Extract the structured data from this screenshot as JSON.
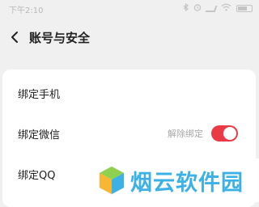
{
  "status_bar": {
    "time": "下午2:10",
    "icons": [
      "bluetooth-icon",
      "alarm-icon",
      "signal-icon",
      "wifi-icon",
      "battery-icon"
    ]
  },
  "header": {
    "title": "账号与安全"
  },
  "rows": [
    {
      "label": "绑定手机"
    },
    {
      "label": "绑定微信",
      "action_text": "解除绑定",
      "toggle_on": true
    },
    {
      "label": "绑定QQ"
    }
  ],
  "colors": {
    "background": "#f0f0f0",
    "card": "#ffffff",
    "toggle_on": "#ea3a46",
    "watermark_text": "#3cb1e6"
  },
  "watermark": {
    "text": "烟云软件园"
  }
}
